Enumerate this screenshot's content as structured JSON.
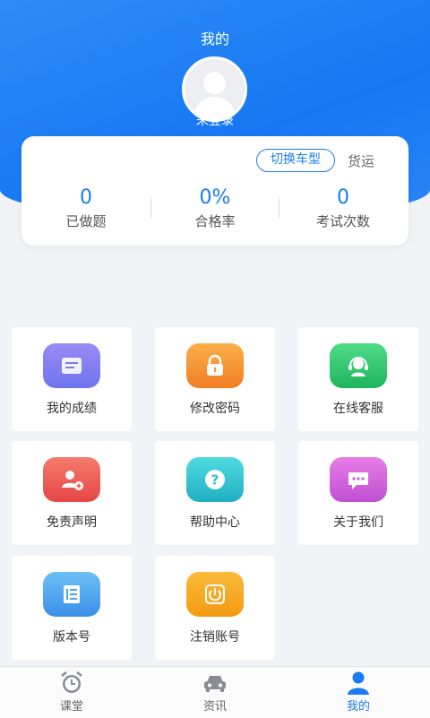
{
  "header": {
    "title": "我的",
    "login_status": "未登录"
  },
  "stats": {
    "switch_label": "切换车型",
    "vehicle_type": "货运",
    "items": [
      {
        "value": "0",
        "label": "已做题"
      },
      {
        "value": "0%",
        "label": "合格率"
      },
      {
        "value": "0",
        "label": "考试次数"
      }
    ]
  },
  "menu": [
    {
      "label": "我的成绩",
      "icon": "score-report-icon",
      "color": "#7b7cf0"
    },
    {
      "label": "修改密码",
      "icon": "lock-icon",
      "color": "#f6962e"
    },
    {
      "label": "在线客服",
      "icon": "customer-service-icon",
      "color": "#2fc46f"
    },
    {
      "label": "免责声明",
      "icon": "user-disclaimer-icon",
      "color": "#ef5757"
    },
    {
      "label": "帮助中心",
      "icon": "help-question-icon",
      "color": "#2fc0cf"
    },
    {
      "label": "关于我们",
      "icon": "message-bubble-icon",
      "color": "#d05ad9"
    },
    {
      "label": "版本号",
      "icon": "document-version-icon",
      "color": "#4aa3ef"
    },
    {
      "label": "注销账号",
      "icon": "power-icon",
      "color": "#f7a51e"
    }
  ],
  "tabbar": [
    {
      "label": "课堂",
      "icon": "alarm-clock-icon",
      "active": false
    },
    {
      "label": "资讯",
      "icon": "car-icon",
      "active": false
    },
    {
      "label": "我的",
      "icon": "person-icon",
      "active": true
    }
  ],
  "colors": {
    "accent": "#1a7cf0",
    "header": "#1677f2"
  }
}
